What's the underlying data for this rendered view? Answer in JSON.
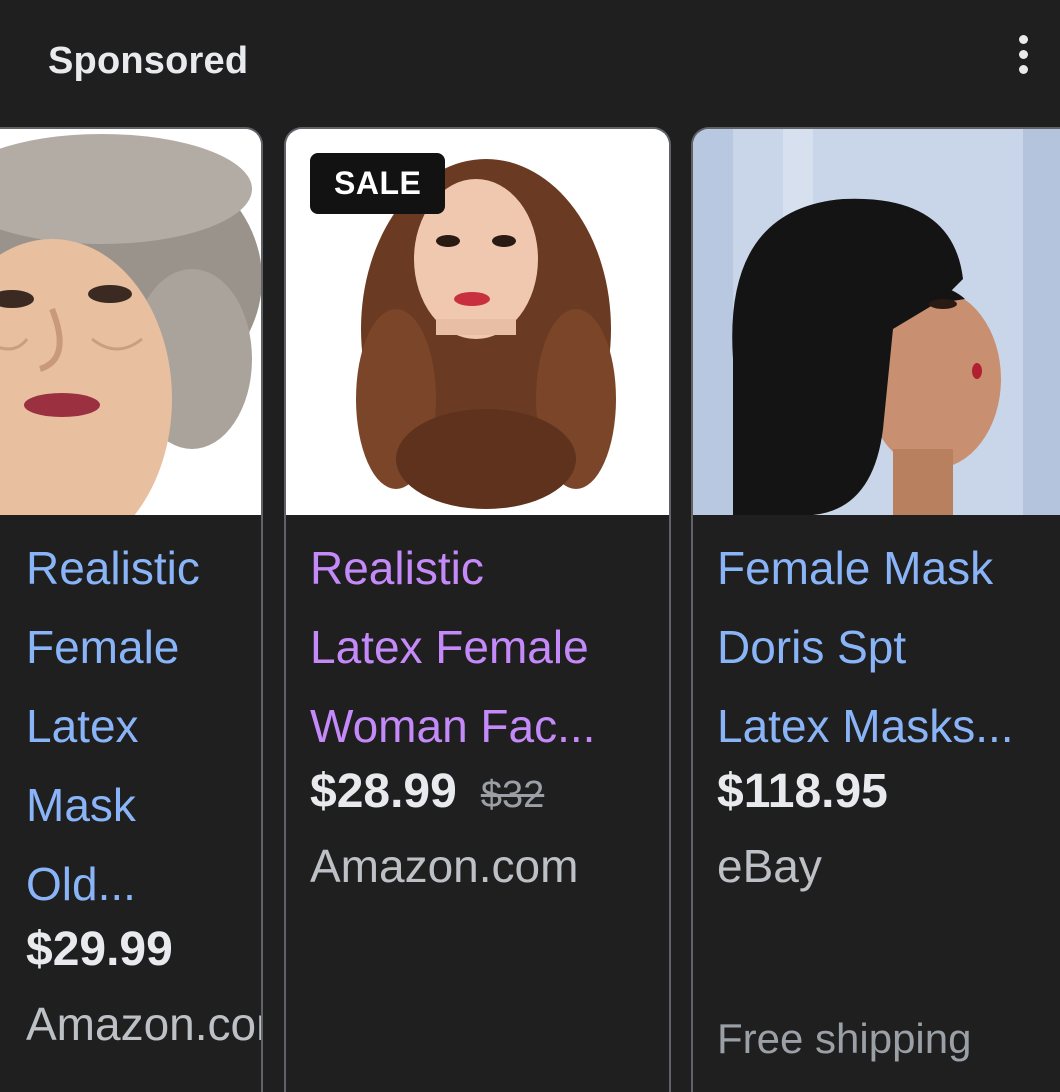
{
  "header": {
    "title": "Sponsored"
  },
  "products": [
    {
      "title": "Realistic\nFemale Latex\nMask Old...",
      "price": "$29.99",
      "merchant": "Amazon.com",
      "visited": false
    },
    {
      "badge": "SALE",
      "title": "Realistic\nLatex Female\nWoman Fac...",
      "price": "$28.99",
      "old_price": "$32",
      "merchant": "Amazon.com",
      "visited": true
    },
    {
      "title": "Female Mask\nDoris Spt\nLatex Masks...",
      "price": "$118.95",
      "merchant": "eBay",
      "shipping": "Free shipping",
      "visited": false
    }
  ],
  "icons": {
    "menu": "more-vert-icon"
  },
  "colors": {
    "background": "#1f1f1f",
    "link": "#8ab4f8",
    "visited_link": "#c58af9",
    "text": "#e8eaed",
    "muted": "#9aa0a6",
    "card_border": "#5f6368"
  }
}
